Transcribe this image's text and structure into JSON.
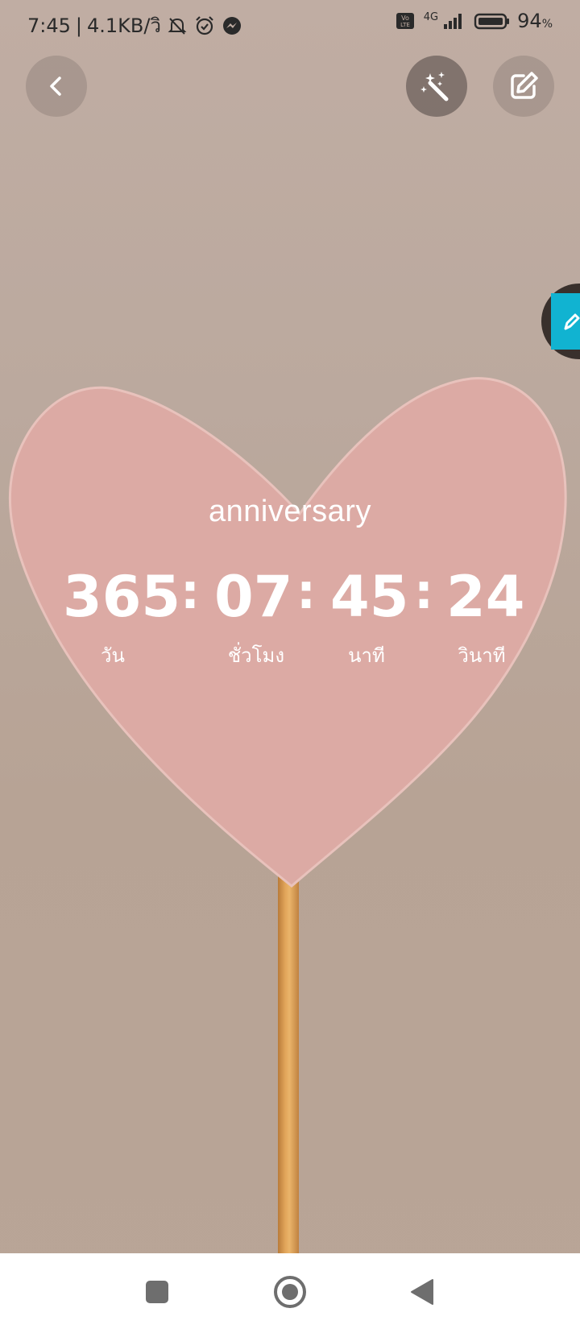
{
  "status_bar": {
    "time": "7:45",
    "net_speed": "4.1KB/วิ",
    "network": "4G",
    "battery": "94",
    "battery_unit": "%"
  },
  "countdown": {
    "title": "anniversary",
    "days": "365",
    "hours": "07",
    "minutes": "45",
    "seconds": "24",
    "separator": ":",
    "labels": {
      "days": "วัน",
      "hours": "ชั่วโมง",
      "minutes": "นาที",
      "seconds": "วินาที"
    }
  },
  "icons": {
    "back": "chevron-left-icon",
    "magic": "magic-wand-icon",
    "edit": "edit-icon",
    "side": "pencil-icon",
    "nav_recent": "square-icon",
    "nav_home": "circle-icon",
    "nav_back": "triangle-left-icon"
  },
  "colors": {
    "heart": "#dba9a3",
    "side_tab": "#11b3d1",
    "text": "#ffffff"
  }
}
